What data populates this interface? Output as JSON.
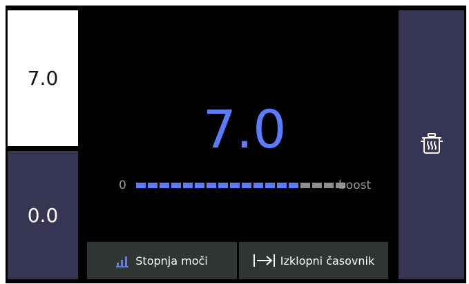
{
  "zones": {
    "left_top_value": "7.0",
    "left_bottom_value": "0.0"
  },
  "main": {
    "value": "7.0",
    "scale_min_label": "0",
    "scale_max_label": "boost",
    "level_segments_active": 14,
    "level_segments_total": 18
  },
  "buttons": {
    "power_level_label": "Stopnja moči",
    "power_level_icon": "bar-chart-icon",
    "timer_label": "Izklopni časovnik",
    "timer_icon": "arrow-to-line-icon"
  },
  "right_panel": {
    "icon": "pot-icon"
  },
  "colors": {
    "accent": "#5b7cff",
    "panel": "#363654",
    "background": "#000000",
    "button_bg": "#2f3533",
    "inactive_segment": "#8f8f8f"
  }
}
